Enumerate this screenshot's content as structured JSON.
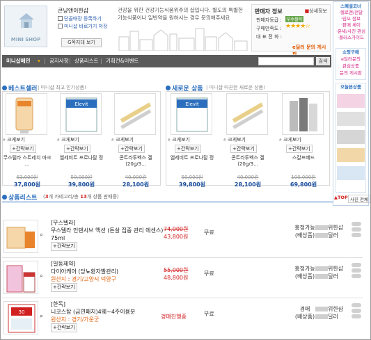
{
  "shop": {
    "logo_label": "MINI SHOP",
    "name": "큰냥앤이한샵",
    "opt1": "단골매장 등록하기",
    "opt2": "미니샵 바로가기 저장",
    "grade_btn": "G쪽지대 보기",
    "desc": "건강을 위한 건강기능식품위주의 샵입니다. 별도의 특별한 기능식품이나 일반약을 원하시는 경우 문의해주세요"
  },
  "seller_info": {
    "title": "판매자 정보",
    "detail": "상세정보",
    "grade_label": "판매자등급 :",
    "grade_val": "우수셀러",
    "satisfaction_label": "구매만족도 :",
    "rep_label": "대 표 전 화 :",
    "board": "e딜러 문의 게시판"
  },
  "nav": {
    "home": "미니샵메인",
    "notice": "공지사항",
    "products": "상품리스트",
    "events": "기획전&이벤트",
    "search_btn": "검색"
  },
  "best": {
    "title": "베스트셀러",
    "sub": "미니샵 최고 인기상품!"
  },
  "newp": {
    "title": "새로운 상품",
    "sub": "미니샵 따끈한 새로운 상품!"
  },
  "labels": {
    "zoom": "크게보기",
    "cart": "+간략보기"
  },
  "best_items": [
    {
      "name": "무스텔라 스트레치 마크 ...",
      "old": "63,000원",
      "new": "37,800원"
    },
    {
      "name": "엘레비트 프로나탈 정",
      "old": "50,000원",
      "new": "39,800원"
    },
    {
      "name": "콘트라투벡스 겔(20g/3...",
      "old": "40,000원",
      "new": "28,100원"
    }
  ],
  "new_items": [
    {
      "name": "엘레비트 프로나탈 정",
      "old": "50,000원",
      "new": "39,800원"
    },
    {
      "name": "콘트라투벡스 겔(20g/3...",
      "old": "40,000원",
      "new": "28,100원"
    },
    {
      "name": "스칼프메드",
      "old": "100,000원",
      "new": "69,800원"
    }
  ],
  "list": {
    "title": "상품리스트",
    "sub_pre": "(",
    "cat_count": "3",
    "sub_mid": "개 카테고리/총 ",
    "item_count": "13",
    "sub_post": "개 상품 판매중)"
  },
  "rows": [
    {
      "brand": "[무스텔라]",
      "name": "무스텔라 인텐시브 액션 (튼살 집중 관리 에센스) 75ml",
      "origin": "",
      "old": "74,000원",
      "new": "43,800원",
      "ship": "무료",
      "stock": "흥정가능\n(배상품)",
      "seller": "위한샵",
      "seller2": "딜러"
    },
    {
      "brand": "[일동제약]",
      "name": "다이아케어 (당뇨환자발관리)",
      "origin": "원산지 : 경기/고양시 덕양구",
      "old": "55,000원",
      "new": "48,800원",
      "ship": "무료",
      "stock": "흥정가능\n(배상품)",
      "seller": "위한샵",
      "seller2": "딜러"
    },
    {
      "brand": "[한독]",
      "name": "니코스탑 (금연패치)4웨~4주이용분",
      "origin": "원산지 : 경기/가운군",
      "old": "",
      "new": "경매진행중",
      "ship": "무료",
      "stock": "경매\n(배상품)",
      "seller": "위한샵",
      "seller2": "딜러"
    }
  ],
  "sidebar": {
    "top": [
      "스페셜코너",
      "·헬로앤/전달",
      "·임오 점보",
      "·판매 세이",
      "·운세/사진 관심",
      "·플러스가이드"
    ],
    "guide": "쇼핑구매",
    "guide_items": [
      "e딜러문의",
      "관심상품",
      "문의 게시판"
    ],
    "recent": "오늘본상품",
    "top_btn": "TOP",
    "all_btn": "사진 전체"
  }
}
